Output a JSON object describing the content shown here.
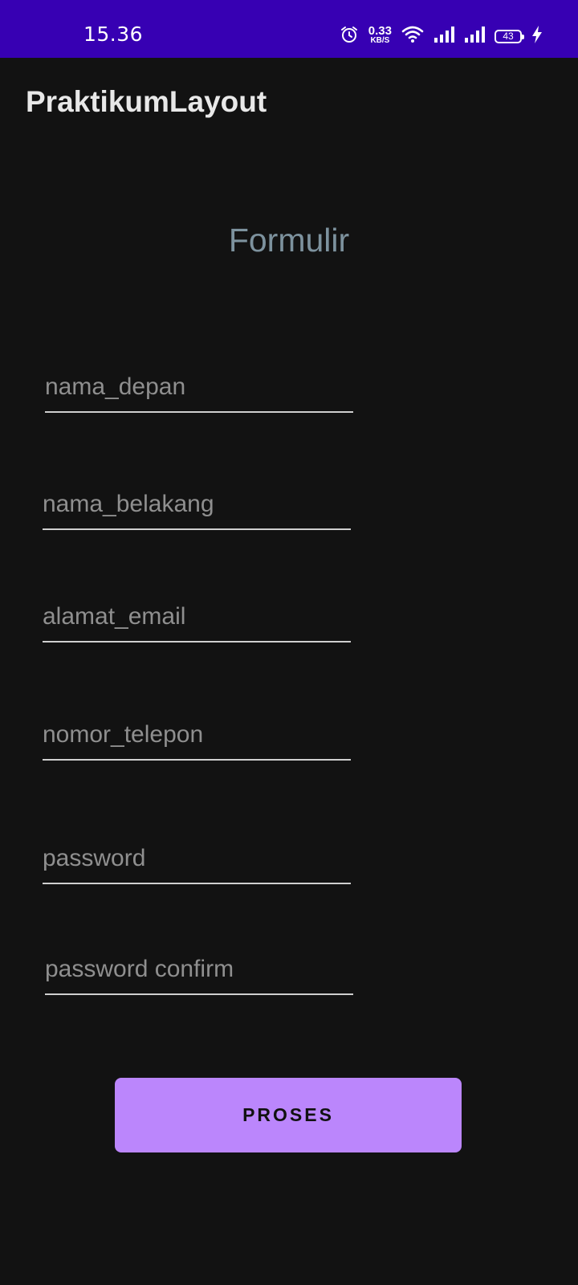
{
  "status_bar": {
    "time": "15.36",
    "net_speed_value": "0.33",
    "net_speed_unit": "KB/S",
    "battery_level": "43",
    "icons": [
      "alarm-icon",
      "wifi-icon",
      "signal-icon",
      "signal-icon",
      "battery-icon",
      "charging-icon"
    ],
    "background_color": "#3700b3"
  },
  "app_bar": {
    "title": "PraktikumLayout"
  },
  "form": {
    "heading": "Formulir",
    "fields": [
      {
        "placeholder": "nama_depan",
        "value": ""
      },
      {
        "placeholder": "nama_belakang",
        "value": ""
      },
      {
        "placeholder": "alamat_email",
        "value": ""
      },
      {
        "placeholder": "nomor_telepon",
        "value": ""
      },
      {
        "placeholder": "password",
        "value": ""
      },
      {
        "placeholder": "password confirm",
        "value": ""
      }
    ],
    "submit_label": "PROSES",
    "submit_color": "#bb86fc"
  },
  "theme": {
    "background": "#121212",
    "heading_color": "#7d929e"
  }
}
